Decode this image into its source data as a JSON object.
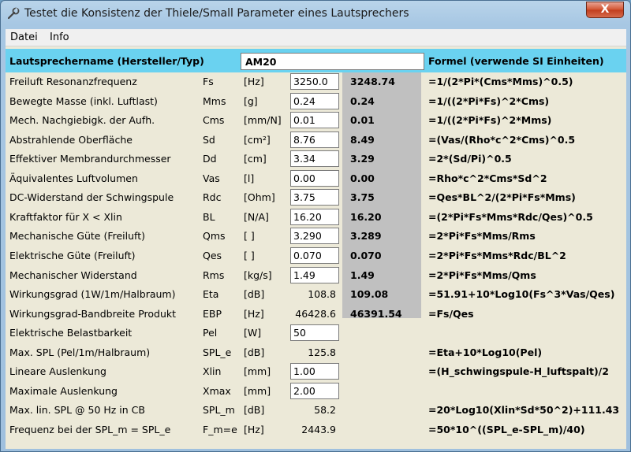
{
  "window": {
    "title": "Testet die Konsistenz der Thiele/Small Parameter eines Lautsprechers",
    "close_label": "X"
  },
  "menu": {
    "items": [
      "Datei",
      "Info"
    ]
  },
  "header": {
    "name_label": "Lautsprechername (Hersteller/Typ)",
    "name_value": "AM20",
    "formula_label": "Formel (verwende SI Einheiten)"
  },
  "rows": [
    {
      "name": "Freiluft Resonanzfrequenz",
      "symbol": "Fs",
      "unit": "[Hz]",
      "value": "3250.0",
      "editable": true,
      "calc": "3248.74",
      "formula": "=1/(2*Pi*(Cms*Mms)^0.5)"
    },
    {
      "name": "Bewegte Masse (inkl. Luftlast)",
      "symbol": "Mms",
      "unit": "[g]",
      "value": "0.24",
      "editable": true,
      "calc": "0.24",
      "formula": "=1/((2*Pi*Fs)^2*Cms)"
    },
    {
      "name": "Mech. Nachgiebigk. der Aufh.",
      "symbol": "Cms",
      "unit": "[mm/N]",
      "value": "0.01",
      "editable": true,
      "calc": "0.01",
      "formula": "=1/((2*Pi*Fs)^2*Mms)"
    },
    {
      "name": "Abstrahlende Oberfläche",
      "symbol": "Sd",
      "unit": "[cm²]",
      "value": "8.76",
      "editable": true,
      "calc": "8.49",
      "formula": "=(Vas/(Rho*c^2*Cms)^0.5"
    },
    {
      "name": "Effektiver Membrandurchmesser",
      "symbol": "Dd",
      "unit": "[cm]",
      "value": "3.34",
      "editable": true,
      "calc": "3.29",
      "formula": "=2*(Sd/Pi)^0.5"
    },
    {
      "name": "Äquivalentes Luftvolumen",
      "symbol": "Vas",
      "unit": "[l]",
      "value": "0.00",
      "editable": true,
      "calc": "0.00",
      "formula": "=Rho*c^2*Cms*Sd^2"
    },
    {
      "name": "DC-Widerstand der Schwingspule",
      "symbol": "Rdc",
      "unit": "[Ohm]",
      "value": "3.75",
      "editable": true,
      "calc": "3.75",
      "formula": "=Qes*BL^2/(2*Pi*Fs*Mms)"
    },
    {
      "name": "Kraftfaktor für X < Xlin",
      "symbol": "BL",
      "unit": "[N/A]",
      "value": "16.20",
      "editable": true,
      "calc": "16.20",
      "formula": "=(2*Pi*Fs*Mms*Rdc/Qes)^0.5"
    },
    {
      "name": "Mechanische Güte (Freiluft)",
      "symbol": "Qms",
      "unit": "[ ]",
      "value": "3.290",
      "editable": true,
      "calc": "3.289",
      "formula": "=2*Pi*Fs*Mms/Rms"
    },
    {
      "name": "Elektrische Güte (Freiluft)",
      "symbol": "Qes",
      "unit": "[ ]",
      "value": "0.070",
      "editable": true,
      "calc": "0.070",
      "formula": "=2*Pi*Fs*Mms*Rdc/BL^2"
    },
    {
      "name": "Mechanischer Widerstand",
      "symbol": "Rms",
      "unit": "[kg/s]",
      "value": "1.49",
      "editable": true,
      "calc": "1.49",
      "formula": "=2*Pi*Fs*Mms/Qms"
    },
    {
      "name": "Wirkungsgrad (1W/1m/Halbraum)",
      "symbol": "Eta",
      "unit": "[dB]",
      "value": "108.8",
      "editable": false,
      "calc": "109.08",
      "formula": "=51.91+10*Log10(Fs^3*Vas/Qes)"
    },
    {
      "name": "Wirkungsgrad-Bandbreite Produkt",
      "symbol": "EBP",
      "unit": "[Hz]",
      "value": "46428.6",
      "editable": false,
      "calc": "46391.54",
      "formula": "=Fs/Qes"
    },
    {
      "name": "Elektrische Belastbarkeit",
      "symbol": "Pel",
      "unit": "[W]",
      "value": "50",
      "editable": true,
      "calc": "",
      "formula": ""
    },
    {
      "name": "Max. SPL (Pel/1m/Halbraum)",
      "symbol": "SPL_e",
      "unit": "[dB]",
      "value": "125.8",
      "editable": false,
      "calc": "",
      "formula": "=Eta+10*Log10(Pel)"
    },
    {
      "name": "Lineare Auslenkung",
      "symbol": "Xlin",
      "unit": "[mm]",
      "value": "1.00",
      "editable": true,
      "calc": "",
      "formula": "=(H_schwingspule-H_luftspalt)/2"
    },
    {
      "name": "Maximale Auslenkung",
      "symbol": "Xmax",
      "unit": "[mm]",
      "value": "2.00",
      "editable": true,
      "calc": "",
      "formula": ""
    },
    {
      "name": "Max. lin. SPL @ 50 Hz in CB",
      "symbol": "SPL_m",
      "unit": "[dB]",
      "value": "58.2",
      "editable": false,
      "calc": "",
      "formula": "=20*Log10(Xlin*Sd*50^2)+111.43"
    },
    {
      "name": "Frequenz bei der SPL_m = SPL_e",
      "symbol": "F_m=e",
      "unit": "[Hz]",
      "value": "2443.9",
      "editable": false,
      "calc": "",
      "formula": "=50*10^((SPL_e-SPL_m)/40)"
    }
  ],
  "colors": {
    "header_bg": "#6ad2f0",
    "calc_panel_bg": "#c0c0c0",
    "form_bg": "#ece9d8",
    "close_button": "#d2532f"
  }
}
